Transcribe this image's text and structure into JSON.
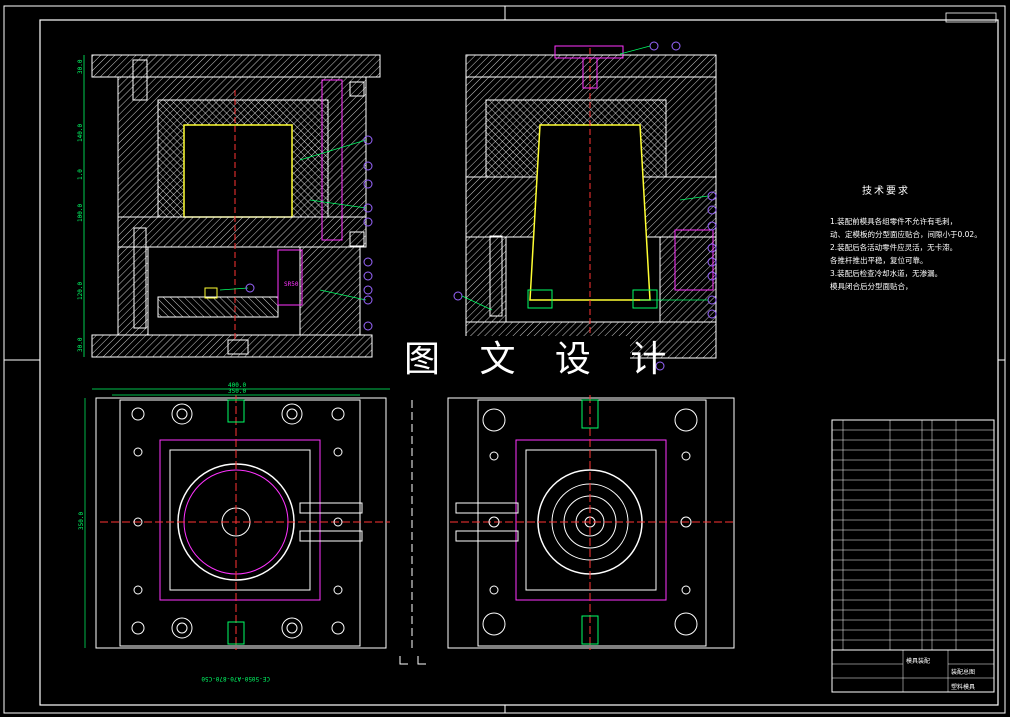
{
  "watermark": "图 文 设 计",
  "notes": {
    "title": "技术要求",
    "lines": [
      "1.装配前模具各组零件不允许有毛刺，",
      "动、定模板的分型面应贴合，间隙小于0.02。",
      "2.装配后各活动零件应灵活，无卡滞。",
      "各推杆推出平稳，复位可靠。",
      "3.装配后检查冷却水道，无渗漏。",
      "模具闭合后分型面贴合，"
    ]
  },
  "dimensions": {
    "left_vertical": [
      "30.0",
      "140.0",
      "1.0",
      "100.0",
      "120.0",
      "30.0"
    ],
    "width_outer": "400.0",
    "width_inner": "350.0",
    "height_side": "350.0",
    "rotated_text": "CE-5050-A70-870-C50"
  },
  "title_block": {
    "center_label": "模具装配",
    "right_label": "装配总图",
    "bottom_label": "塑料模具"
  },
  "colors": {
    "background": "#000000",
    "line": "#ffffff",
    "hatch": "#ffffff",
    "cavity": "#ffff33",
    "balloon": "#9966ff",
    "leader": "#00ff66",
    "red_center": "#ff3333",
    "magenta": "#ff33ff",
    "cyan": "#33ffff"
  }
}
